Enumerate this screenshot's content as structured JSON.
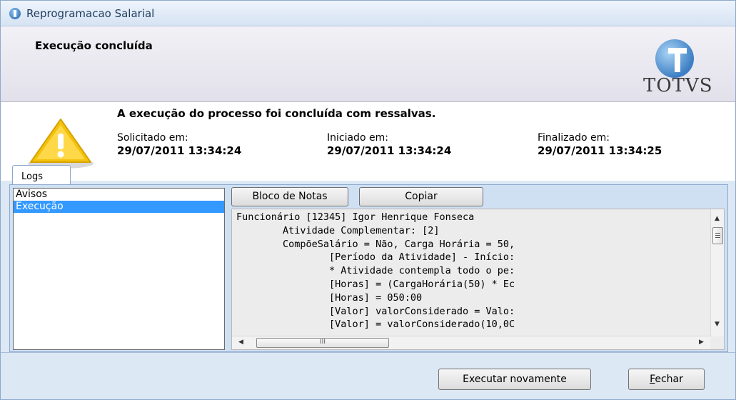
{
  "window": {
    "title": "Reprogramacao Salarial"
  },
  "header": {
    "title": "Execução concluída",
    "brand": "TOTVS"
  },
  "summary": {
    "message": "A execução do processo foi concluída com ressalvas.",
    "requested_label": "Solicitado em:",
    "requested_value": "29/07/2011 13:34:24",
    "started_label": "Iniciado em:",
    "started_value": "29/07/2011 13:34:24",
    "finished_label": "Finalizado em:",
    "finished_value": "29/07/2011 13:34:25"
  },
  "tabs": [
    {
      "label": "Logs"
    }
  ],
  "log_types": [
    {
      "label": "Avisos",
      "selected": false
    },
    {
      "label": "Execução",
      "selected": true
    }
  ],
  "toolbar": {
    "notepad_label": "Bloco de Notas",
    "copy_label": "Copiar"
  },
  "log_lines": [
    "Funcionário [12345] Igor Henrique Fonseca",
    "        Atividade Complementar: [2]",
    "        CompõeSalário = Não, Carga Horária = 50,",
    "                [Período da Atividade] - Início:",
    "                * Atividade contempla todo o pe:",
    "                [Horas] = (CargaHorária(50) * Ec",
    "                [Horas] = 050:00",
    "                [Valor] valorConsiderado = Valo:",
    "                [Valor] = valorConsiderado(10,0C"
  ],
  "scrollbar": {
    "h_thumb_grip": "III"
  },
  "footer": {
    "rerun_label": "Executar novamente",
    "close_label_first": "F",
    "close_label_rest": "echar"
  },
  "colors": {
    "selection": "#3399ff",
    "panel": "#cfe0f3",
    "warning": "#f5c400"
  }
}
